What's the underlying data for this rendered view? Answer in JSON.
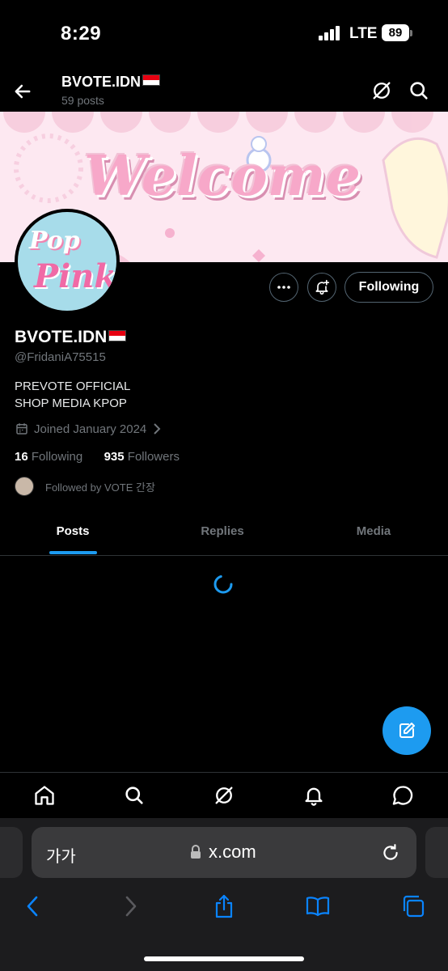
{
  "status_bar": {
    "time": "8:29",
    "network": "LTE",
    "battery": "89"
  },
  "header": {
    "title": "BVOTE.IDN",
    "posts_count": "59 posts"
  },
  "banner": {
    "text": "Welcome"
  },
  "avatar": {
    "line1": "Pop",
    "line2": "Pink"
  },
  "actions": {
    "following_label": "Following"
  },
  "profile": {
    "name": "BVOTE.IDN",
    "handle": "@FridaniA75515",
    "bio_line1": "PREVOTE OFFICIAL",
    "bio_line2": "SHOP MEDIA KPOP",
    "joined": "Joined January 2024",
    "following_count": "16",
    "following_label": "Following",
    "followers_count": "935",
    "followers_label": "Followers",
    "followed_by": "Followed by VOTE 간장"
  },
  "tabs": [
    {
      "label": "Posts",
      "active": true
    },
    {
      "label": "Replies",
      "active": false
    },
    {
      "label": "Media",
      "active": false
    }
  ],
  "browser": {
    "text_size_label": "가가",
    "url": "x.com"
  },
  "colors": {
    "accent": "#1d9bf0",
    "background": "#000000",
    "muted": "#71767b"
  }
}
